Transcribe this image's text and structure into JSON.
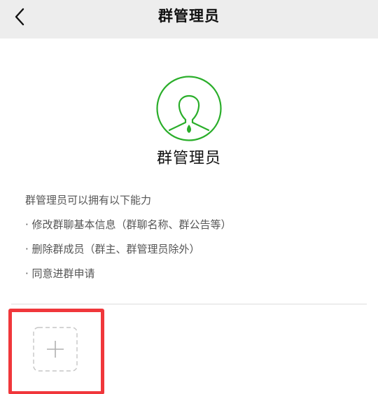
{
  "header": {
    "title": "群管理员",
    "back_icon": "chevron-left-icon"
  },
  "profile": {
    "avatar_icon": "user-silhouette-icon",
    "role_title": "群管理员"
  },
  "description": {
    "intro": "群管理员可以拥有以下能力",
    "abilities": [
      "· 修改群聊基本信息（群聊名称、群公告等）",
      "· 删除群成员（群主、群管理员除外）",
      "· 同意进群申请"
    ]
  },
  "add_member": {
    "icon": "plus-icon"
  },
  "colors": {
    "nav_background": "#ededed",
    "accent_green": "#2aae2a",
    "highlight_red": "#f0373b",
    "text_primary": "#111111",
    "text_secondary": "#555555"
  }
}
